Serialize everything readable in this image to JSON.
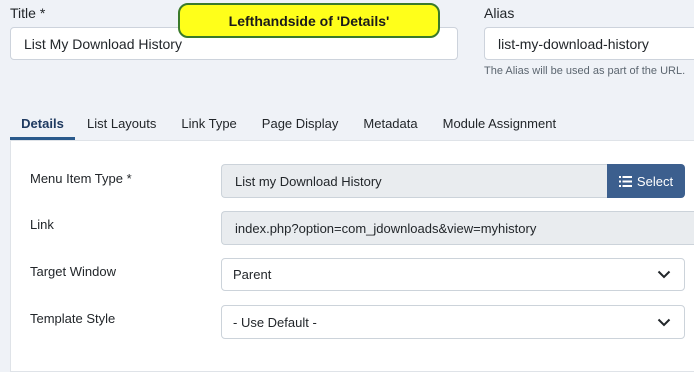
{
  "header": {
    "title_label": "Title *",
    "title_value": "List My Download History",
    "alias_label": "Alias",
    "alias_value": "list-my-download-history",
    "alias_hint": "The Alias will be used as part of the URL."
  },
  "annotation": {
    "callout_text": "Lefthandside of 'Details'"
  },
  "tabs": [
    {
      "label": "Details",
      "active": true
    },
    {
      "label": "List Layouts",
      "active": false
    },
    {
      "label": "Link Type",
      "active": false
    },
    {
      "label": "Page Display",
      "active": false
    },
    {
      "label": "Metadata",
      "active": false
    },
    {
      "label": "Module Assignment",
      "active": false
    }
  ],
  "details": {
    "menu_item_type_label": "Menu Item Type *",
    "menu_item_type_value": "List my Download History",
    "select_button_label": "Select",
    "link_label": "Link",
    "link_value": "index.php?option=com_jdownloads&view=myhistory",
    "target_window_label": "Target Window",
    "target_window_value": "Parent",
    "template_style_label": "Template Style",
    "template_style_value": "- Use Default -"
  },
  "colors": {
    "page_bg": "#eff2f7",
    "accent": "#3c5f8e",
    "callout_bg": "#ffff1a",
    "callout_border": "#3a7a2a"
  },
  "icons": {
    "select_button_icon": "list-icon",
    "dropdown_icon": "chevron-down-icon"
  }
}
